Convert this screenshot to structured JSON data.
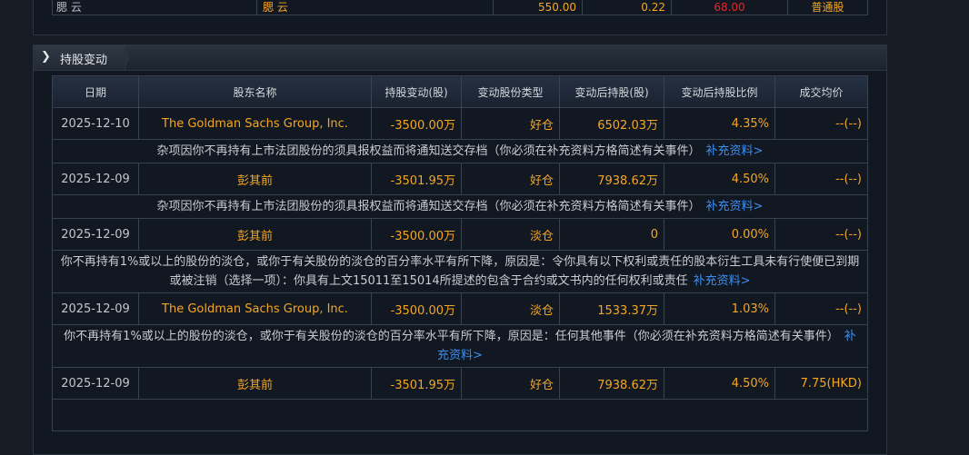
{
  "top_row": {
    "col1": "腮  云",
    "col2": "腮  云",
    "col3": "550.00",
    "col4": "0.22",
    "col5": "68.00",
    "col6": "普通股"
  },
  "section": {
    "title": "持股变动",
    "arrow_icon": "chevron-right-icon"
  },
  "columns": [
    "日期",
    "股东名称",
    "持股变动(股)",
    "变动股份类型",
    "变动后持股(股)",
    "变动后持股比例",
    "成交均价"
  ],
  "link_label": "补充资料>",
  "rows": [
    {
      "date": "2025-12-10",
      "holder": "The Goldman Sachs Group, Inc.",
      "change": "-3500.00万",
      "type": "好仓",
      "after": "6502.03万",
      "ratio": "4.35%",
      "price": "--(--)",
      "note": "杂项因你不再持有上市法团股份的须具报权益而将通知送交存档（你必须在补充资料方格简述有关事件）"
    },
    {
      "date": "2025-12-09",
      "holder": "彭其前",
      "change": "-3501.95万",
      "type": "好仓",
      "after": "7938.62万",
      "ratio": "4.50%",
      "price": "--(--)",
      "note": "杂项因你不再持有上市法团股份的须具报权益而将通知送交存档（你必须在补充资料方格简述有关事件）"
    },
    {
      "date": "2025-12-09",
      "holder": "彭其前",
      "change": "-3500.00万",
      "type": "淡仓",
      "after": "0",
      "ratio": "0.00%",
      "price": "--(--)",
      "note": "你不再持有1%或以上的股份的淡仓，或你于有关股份的淡仓的百分率水平有所下降，原因是：令你具有以下权利或责任的股本衍生工具未有行使便已到期或被注销（选择一项）：你具有上文15011至15014所提述的包含于合约或文书内的任何权利或责任"
    },
    {
      "date": "2025-12-09",
      "holder": "The Goldman Sachs Group, Inc.",
      "change": "-3500.00万",
      "type": "淡仓",
      "after": "1533.37万",
      "ratio": "1.03%",
      "price": "--(--)",
      "note": "你不再持有1%或以上的股份的淡仓，或你于有关股份的淡仓的百分率水平有所下降，原因是：任何其他事件（你必须在补充资料方格简述有关事件）"
    },
    {
      "date": "2025-12-09",
      "holder": "彭其前",
      "change": "-3501.95万",
      "type": "好仓",
      "after": "7938.62万",
      "ratio": "4.50%",
      "price": "7.75(HKD)",
      "note": ""
    }
  ]
}
